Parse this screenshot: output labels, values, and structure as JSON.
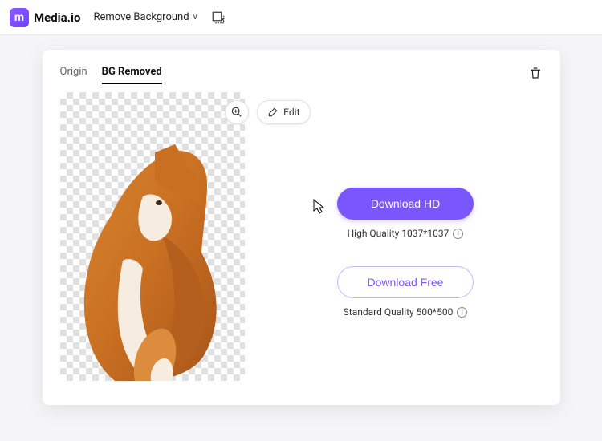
{
  "header": {
    "logo_letter": "m",
    "site_name": "Media.io",
    "tool_name": "Remove Background"
  },
  "tabs": {
    "origin": "Origin",
    "bg_removed": "BG Removed"
  },
  "controls": {
    "edit_label": "Edit"
  },
  "download": {
    "hd_label": "Download HD",
    "hd_info": "High Quality 1037*1037",
    "free_label": "Download Free",
    "free_info": "Standard Quality 500*500"
  }
}
